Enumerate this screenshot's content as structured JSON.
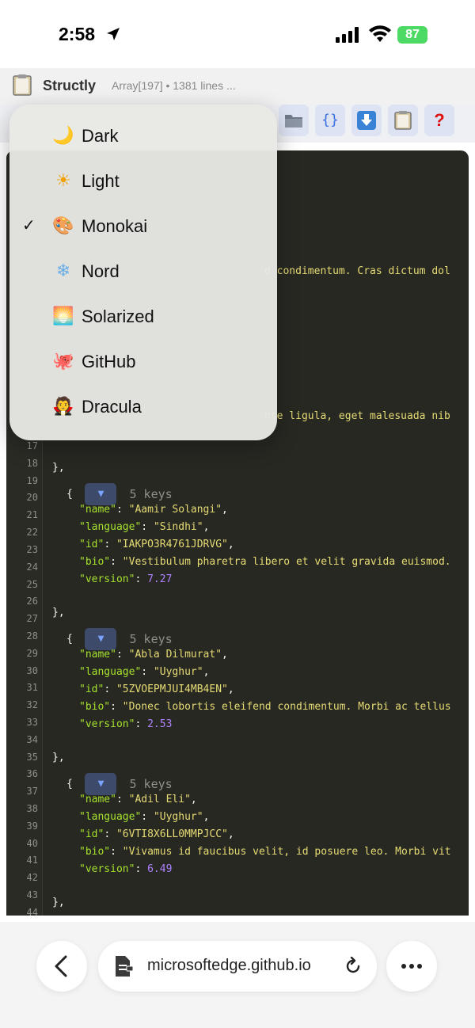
{
  "status_bar": {
    "time": "2:58",
    "battery": "87"
  },
  "app": {
    "name": "Structly",
    "meta": "Array[197] • 1381 lines ..."
  },
  "toolbar": {
    "buttons": [
      {
        "icon": "folder-icon"
      },
      {
        "icon": "braces-icon",
        "label": "{}"
      },
      {
        "icon": "download-icon"
      },
      {
        "icon": "clipboard-icon"
      },
      {
        "icon": "help-icon",
        "label": "?"
      }
    ]
  },
  "theme_menu": {
    "items": [
      {
        "label": "Dark",
        "emoji": "🌙",
        "selected": false
      },
      {
        "label": "Light",
        "emoji": "☀",
        "selected": false
      },
      {
        "label": "Monokai",
        "emoji": "🎨",
        "selected": true
      },
      {
        "label": "Nord",
        "emoji": "❄",
        "selected": false
      },
      {
        "label": "Solarized",
        "emoji": "🌅",
        "selected": false
      },
      {
        "label": "GitHub",
        "emoji": "🐙",
        "selected": false
      },
      {
        "label": "Dracula",
        "emoji": "🧛",
        "selected": false
      }
    ],
    "check_mark": "✓"
  },
  "editor": {
    "partial_lines": {
      "line_a": "d condimentum. Cras dictum dol",
      "line_b": "nte ligula, eget malesuada nib"
    },
    "line_numbers": [
      "17",
      "18",
      "19",
      "20",
      "21",
      "22",
      "23",
      "24",
      "25",
      "26",
      "27",
      "28",
      "29",
      "30",
      "31",
      "32",
      "33",
      "34",
      "35",
      "36",
      "37",
      "38",
      "39",
      "40",
      "41",
      "42",
      "43",
      "44"
    ],
    "toggle_glyph": "▼",
    "keys_label": "5 keys",
    "records": [
      {
        "name": "\"Aamir Solangi\"",
        "language": "\"Sindhi\"",
        "id": "\"IAKPO3R4761JDRVG\"",
        "bio": "\"Vestibulum pharetra libero et velit gravida euismod.",
        "version": "7.27"
      },
      {
        "name": "\"Abla Dilmurat\"",
        "language": "\"Uyghur\"",
        "id": "\"5ZVOEPMJUI4MB4EN\"",
        "bio": "\"Donec lobortis eleifend condimentum. Morbi ac tellus",
        "version": "2.53"
      },
      {
        "name": "\"Adil Eli\"",
        "language": "\"Uyghur\"",
        "id": "\"6VTI8X6LL0MMPJCC\"",
        "bio": "\"Vivamus id faucibus velit, id posuere leo. Morbi vit",
        "version": "6.49"
      }
    ],
    "keys": {
      "name": "\"name\"",
      "language": "\"language\"",
      "id": "\"id\"",
      "bio": "\"bio\"",
      "version": "\"version\""
    },
    "punct": {
      "close": "},",
      "open": "{",
      "colon_comma": ": ",
      "comma": ","
    }
  },
  "bottom_bar": {
    "url": "microsoftedge.github.io"
  }
}
